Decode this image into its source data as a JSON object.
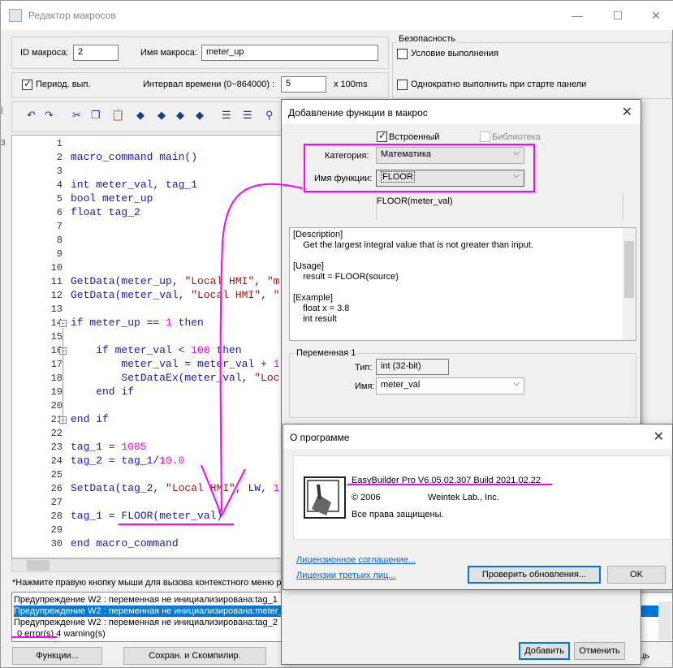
{
  "window": {
    "title": "Редактор макросов",
    "minimize": "—",
    "maximize": "☐",
    "close": "✕"
  },
  "top": {
    "id_label": "ID макроса:",
    "id_value": "2",
    "name_label": "Имя макроса:",
    "name_value": "meter_up",
    "periodic_label": "Период. вып.",
    "interval_label": "Интервал времени (0~864000) :",
    "interval_value": "5",
    "interval_unit": "x 100ms"
  },
  "security": {
    "title": "Безопасность",
    "condition": "Условие выполнения",
    "once": "Однократно выполнить при старте панели"
  },
  "editor": {
    "lines": [
      {
        "n": "1",
        "t": ""
      },
      {
        "n": "2",
        "t": "macro_command main()"
      },
      {
        "n": "3",
        "t": ""
      },
      {
        "n": "4",
        "t": "int meter_val, tag_1"
      },
      {
        "n": "5",
        "t": "bool meter_up"
      },
      {
        "n": "6",
        "t": "float tag_2"
      },
      {
        "n": "7",
        "t": ""
      },
      {
        "n": "8",
        "t": ""
      },
      {
        "n": "9",
        "t": ""
      },
      {
        "n": "10",
        "t": ""
      },
      {
        "n": "11",
        "t": "GetData(meter_up, \"Local HMI\", \"m"
      },
      {
        "n": "12",
        "t": "GetData(meter_val, \"Local HMI\", \""
      },
      {
        "n": "13",
        "t": ""
      },
      {
        "n": "14",
        "t": "if meter_up == 1 then"
      },
      {
        "n": "15",
        "t": ""
      },
      {
        "n": "16",
        "t": "    if meter_val < 100 then"
      },
      {
        "n": "17",
        "t": "        meter_val = meter_val + 1"
      },
      {
        "n": "18",
        "t": "        SetDataEx(meter_val, \"Loc"
      },
      {
        "n": "19",
        "t": "    end if"
      },
      {
        "n": "20",
        "t": ""
      },
      {
        "n": "21",
        "t": "end if"
      },
      {
        "n": "22",
        "t": ""
      },
      {
        "n": "23",
        "t": "tag_1 = 1085"
      },
      {
        "n": "24",
        "t": "tag_2 = tag_1/10.0"
      },
      {
        "n": "25",
        "t": ""
      },
      {
        "n": "26",
        "t": "SetData(tag_2, \"Local HMI\", LW, 1"
      },
      {
        "n": "27",
        "t": ""
      },
      {
        "n": "28",
        "t": "tag_1 = FLOOR(meter_val)"
      },
      {
        "n": "29",
        "t": ""
      },
      {
        "n": "30",
        "t": "end macro_command"
      }
    ]
  },
  "hint": "*Нажмите правую кнопку мыши для вызова контекстного меню р",
  "log": {
    "lines": [
      "Предупреждение W2 : переменная не инициализирована:tag_1",
      "Предупреждение W2 : переменная не инициализирована:meter_",
      "Предупреждение W2 : переменная не инициализирована:tag_2",
      "0 error(s) 4 warning(s)"
    ]
  },
  "bottom": {
    "functions": "Функции...",
    "save_compile": "Сохран. и Скомпилир.",
    "right_cut": "ць"
  },
  "add_func": {
    "title": "Добавление функции в макрос",
    "builtin": "Встроенный",
    "library": "Библиотека",
    "category_label": "Категория:",
    "category_value": "Математика",
    "func_label": "Имя функции:",
    "func_value": "FLOOR",
    "signature": "FLOOR(meter_val)",
    "desc": [
      "[Description]",
      "    Get the largest integral value that is not greater than input.",
      "",
      "[Usage]",
      "    result = FLOOR(source)",
      "",
      "[Example]",
      "    float x = 3.8",
      "    int result"
    ],
    "var_group": "Переменная 1",
    "type_label": "Тип:",
    "type_value": "int (32-bit)",
    "name_label": "Имя:",
    "name_value": "meter_val",
    "add": "Добавить",
    "cancel": "Отменить"
  },
  "about": {
    "title": "О программе",
    "version": "EasyBuilder Pro V6.05.02.307 Build 2021.02.22",
    "copyright": "© 2006",
    "company": "Weintek Lab., Inc.",
    "rights": "Все права защищены.",
    "license": "Лицензионное соглашение...",
    "third": "Лицензии третьих лиц...",
    "check": "Проверить обновления...",
    "ok": "OK"
  },
  "colors": {
    "annotation": "#ff00ff",
    "select": "#0078d7"
  }
}
